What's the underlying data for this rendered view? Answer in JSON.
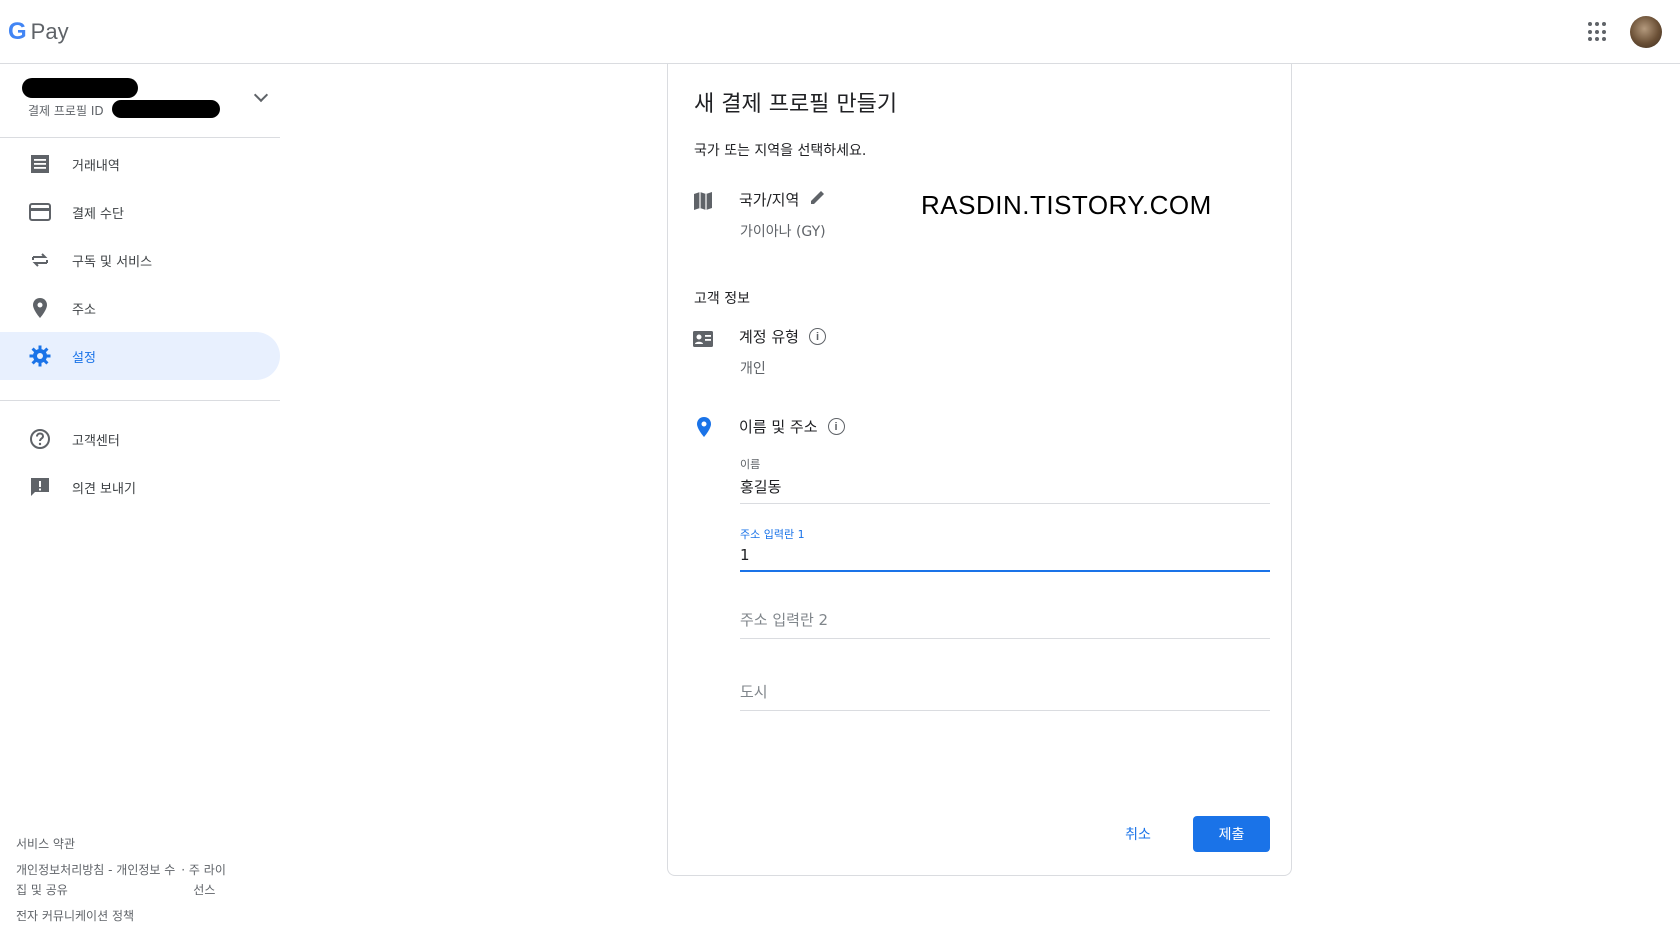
{
  "header": {
    "logo_g": "G",
    "logo_text": "Pay",
    "apps_icon": "apps-grid-icon",
    "avatar_icon": "user-avatar"
  },
  "sidebar": {
    "account": {
      "profile_id_label": "결제 프로필 ID"
    },
    "items": [
      {
        "label": "거래내역",
        "icon": "receipt-icon"
      },
      {
        "label": "결제 수단",
        "icon": "credit-card-icon"
      },
      {
        "label": "구독 및 서비스",
        "icon": "repeat-icon"
      },
      {
        "label": "주소",
        "icon": "location-pin-icon"
      },
      {
        "label": "설정",
        "icon": "gear-icon",
        "active": true
      }
    ],
    "secondary_items": [
      {
        "label": "고객센터",
        "icon": "help-icon"
      },
      {
        "label": "의견 보내기",
        "icon": "feedback-icon"
      }
    ],
    "footer": {
      "terms": "서비스 약관",
      "privacy_line1": "개인정보처리방침 - 개인정보 수",
      "privacy_line2": "집 및 공유",
      "license_line1": "· 주 라이",
      "license_line2": "선스",
      "communication": "전자 커뮤니케이션 정책"
    }
  },
  "card": {
    "title": "새 결제 프로필 만들기",
    "subtitle": "국가 또는 지역을 선택하세요.",
    "watermark": "RASDIN.TISTORY.COM",
    "country": {
      "title": "국가/지역",
      "value": "가이아나 (GY)"
    },
    "customer_section": "고객 정보",
    "account_type": {
      "title": "계정 유형",
      "value": "개인"
    },
    "name_address": {
      "title": "이름 및 주소",
      "name_label": "이름",
      "name_value": "홍길동",
      "address1_label": "주소 입력란 1",
      "address1_value": "1",
      "address2_placeholder": "주소 입력란 2",
      "city_placeholder": "도시"
    },
    "info_glyph": "i",
    "cancel_label": "취소",
    "submit_label": "제출"
  },
  "colors": {
    "accent": "#1a73e8",
    "active_bg": "#e8f0fe",
    "divider": "#dadce0"
  }
}
